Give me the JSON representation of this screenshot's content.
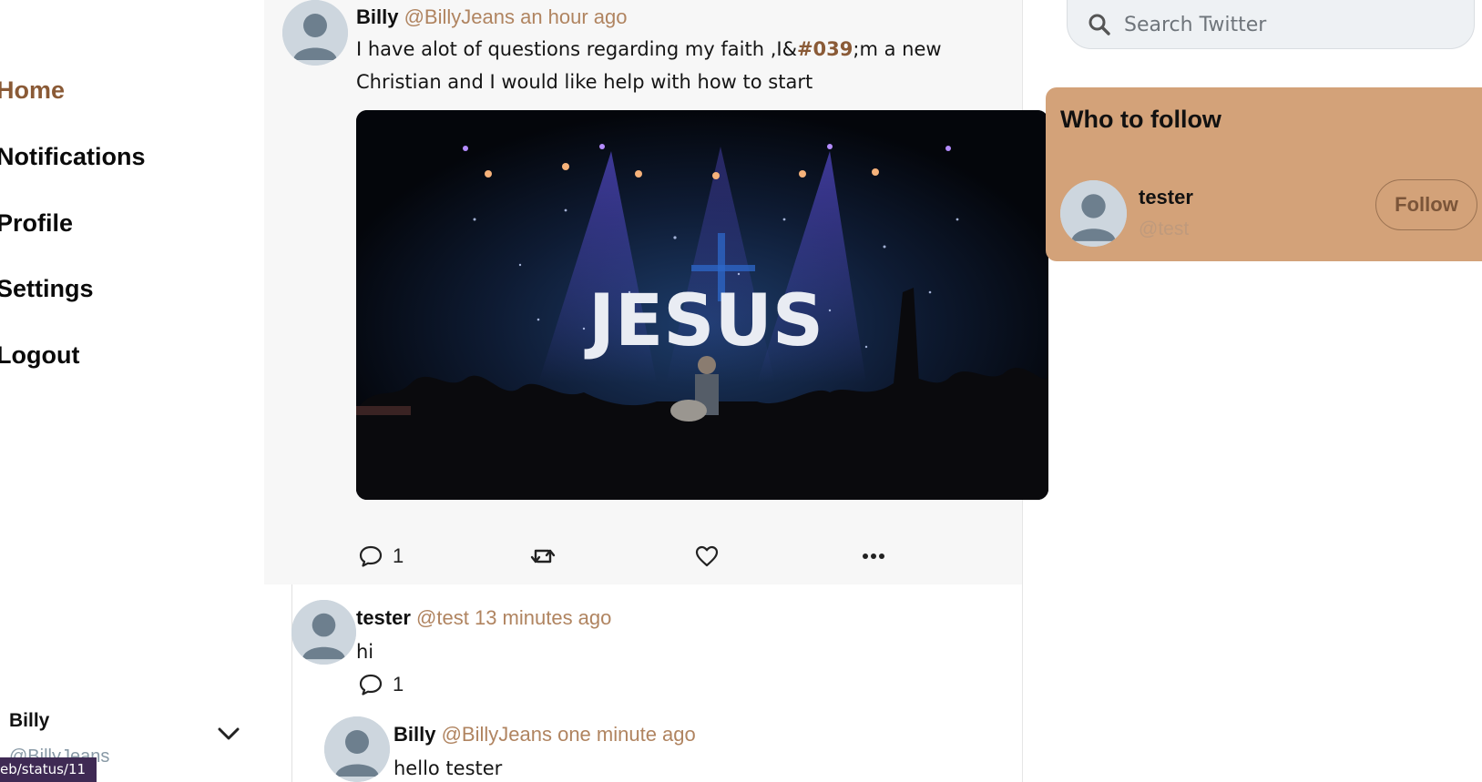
{
  "nav": {
    "items": [
      {
        "label": "Home"
      },
      {
        "label": "Notifications"
      },
      {
        "label": "Profile"
      },
      {
        "label": "Settings"
      },
      {
        "label": "Logout"
      }
    ],
    "user": {
      "name": "Billy",
      "handle": "@BillyJeans"
    },
    "chevron_icon": "chevron-down-icon"
  },
  "status_bar": {
    "text": "eb/status/11"
  },
  "feed": {
    "main_tweet": {
      "name": "Billy",
      "meta": "@BillyJeans an hour ago",
      "body_before": "I have alot of questions regarding my faith ,I&",
      "body_highlight": "#039",
      "body_after": ";m a new Christian and I would like help with how to start",
      "image_text": "JESUS",
      "reply_count": "1"
    },
    "reply": {
      "name": "tester",
      "meta": "@test 13 minutes ago",
      "body": "hi",
      "reply_count": "1"
    },
    "nested_reply": {
      "name": "Billy",
      "meta": "@BillyJeans one minute ago",
      "body": "hello tester"
    }
  },
  "search": {
    "placeholder": "Search Twitter",
    "value": ""
  },
  "who_to_follow": {
    "title": "Who to follow",
    "users": [
      {
        "name": "tester",
        "handle": "@test",
        "button": "Follow"
      }
    ]
  },
  "colors": {
    "accent": "#8a5a36",
    "meta": "#b08460",
    "panel": "#d3a279",
    "feed_bg": "#f7f7f7",
    "status_bar": "#3f2a54"
  }
}
